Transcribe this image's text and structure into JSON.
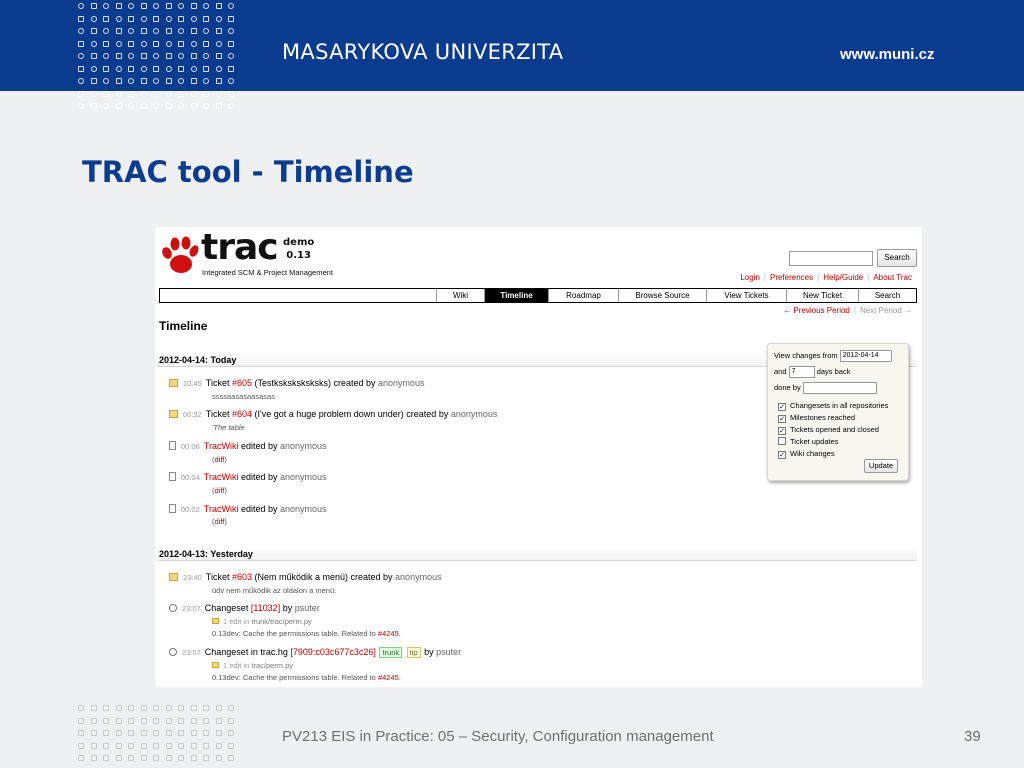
{
  "slide": {
    "university": "MASARYKOVA UNIVERZITA",
    "website": "www.muni.cz",
    "title": "TRAC tool - Timeline",
    "footer": "PV213 EIS in Practice: 05 – Security, Configuration management",
    "page_number": "39"
  },
  "trac": {
    "logo": {
      "word": "trac",
      "tagline": "Integrated SCM & Project Management",
      "demo": "demo",
      "version": "0.13"
    },
    "search": {
      "button": "Search"
    },
    "metanav": [
      "Login",
      "Preferences",
      "Help/Guide",
      "About Trac"
    ],
    "mainnav": [
      "Wiki",
      "Timeline",
      "Roadmap",
      "Browse Source",
      "View Tickets",
      "New Ticket",
      "Search"
    ],
    "active_tab": "Timeline",
    "ctxnav": {
      "prev": "← Previous Period",
      "next": "Next Period →"
    },
    "heading": "Timeline",
    "days": [
      {
        "label": "2012-04-14: Today"
      },
      {
        "label": "2012-04-13: Yesterday"
      }
    ],
    "events": {
      "e1": {
        "time": "10:45",
        "pre": "Ticket ",
        "link": "#605",
        "post": " (Testksksksksksks) created by ",
        "author": "anonymous",
        "desc": "ssssaasasaasasas"
      },
      "e2": {
        "time": "00:32",
        "pre": "Ticket ",
        "link": "#604",
        "post": " (I've got a huge problem down under) created by ",
        "author": "anonymous",
        "desc": "'The table"
      },
      "e3": {
        "time": "00:06",
        "link": "TracWiki",
        "post": " edited by ",
        "author": "anonymous",
        "desc_pre": "(",
        "desc_link": "diff",
        "desc_post": ")"
      },
      "e4": {
        "time": "00:04",
        "link": "TracWiki",
        "post": " edited by ",
        "author": "anonymous",
        "desc_pre": "(",
        "desc_link": "diff",
        "desc_post": ")"
      },
      "e5": {
        "time": "00:02",
        "link": "TracWiki",
        "post": " edited by ",
        "author": "anonymous",
        "desc_pre": "(",
        "desc_link": "diff",
        "desc_post": ")"
      },
      "e6": {
        "time": "23:40",
        "pre": "Ticket ",
        "link": "#603",
        "post": " (Nem működik a menü) created by ",
        "author": "anonymous",
        "desc": "üdv nem működik az oldalon a menü."
      },
      "e7": {
        "time": "23:07",
        "pre": "Changeset ",
        "link": "[11032]",
        "post": " by ",
        "author": "psuter",
        "files_pre": "1 edit  in ",
        "files": "trunk/trac/perm.py",
        "desc_pre": "0.13dev: Cache the permissions table. Related to ",
        "desc_link": "#4245",
        "desc_post": "."
      },
      "e8": {
        "time": "23:07",
        "pre": "Changeset in trac.hg ",
        "link": "[7909:c03c677c3c26]",
        "tag1": "trunk",
        "tag2": "tip",
        "post": " by ",
        "author": "psuter",
        "files_pre": "1 edit  in ",
        "files": "trac/perm.py",
        "desc_pre": "0.13dev: Cache the permissions table. Related to ",
        "desc_link": "#4245",
        "desc_post": "."
      }
    },
    "prefs": {
      "from_label": "View changes from",
      "from_value": "2012-04-14",
      "and_label": "and",
      "days_value": "7",
      "days_label": "days back",
      "doneby_label": "done by",
      "options": [
        {
          "label": "Changesets in all repositories",
          "checked": "✓"
        },
        {
          "label": "Milestones reached",
          "checked": "✓"
        },
        {
          "label": "Tickets opened and closed",
          "checked": "✓"
        },
        {
          "label": "Ticket updates",
          "checked": ""
        },
        {
          "label": "Wiki changes",
          "checked": "✓"
        }
      ],
      "update": "Update"
    }
  },
  "colors": {
    "band": "#0a3b8f",
    "title": "#0b3c90",
    "link": "#bb0000"
  }
}
